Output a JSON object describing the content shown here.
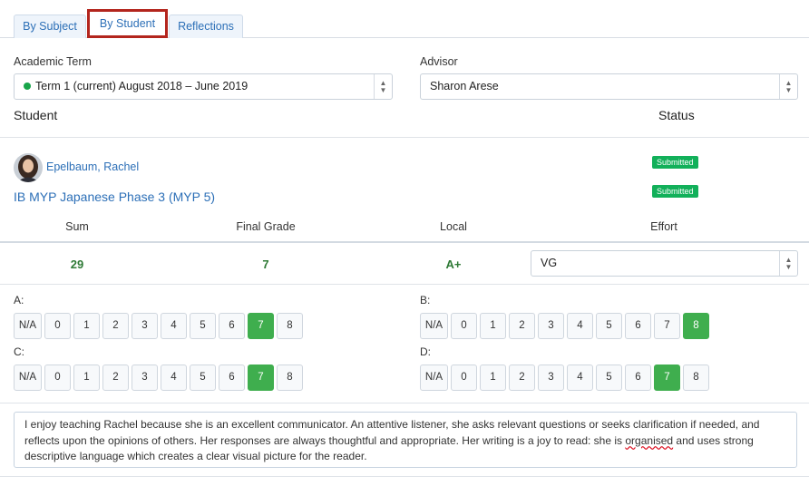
{
  "tabs": [
    {
      "label": "By Subject"
    },
    {
      "label": "By Student"
    },
    {
      "label": "Reflections"
    }
  ],
  "term": {
    "label": "Academic Term",
    "value": "Term 1 (current) August 2018 – June 2019"
  },
  "advisor": {
    "label": "Advisor",
    "value": "Sharon Arese"
  },
  "table": {
    "student_header": "Student",
    "status_header": "Status"
  },
  "student": {
    "name": "Epelbaum, Rachel",
    "status": "Submitted"
  },
  "course": {
    "name": "IB MYP Japanese Phase 3 (MYP 5)",
    "status": "Submitted"
  },
  "grades": {
    "sum_label": "Sum",
    "final_label": "Final Grade",
    "local_label": "Local",
    "effort_label": "Effort",
    "sum": "29",
    "final": "7",
    "local": "A+",
    "effort": "VG"
  },
  "criteria": [
    {
      "label": "A:",
      "options": [
        "N/A",
        "0",
        "1",
        "2",
        "3",
        "4",
        "5",
        "6",
        "7",
        "8"
      ],
      "selected": "7"
    },
    {
      "label": "B:",
      "options": [
        "N/A",
        "0",
        "1",
        "2",
        "3",
        "4",
        "5",
        "6",
        "7",
        "8"
      ],
      "selected": "8"
    },
    {
      "label": "C:",
      "options": [
        "N/A",
        "0",
        "1",
        "2",
        "3",
        "4",
        "5",
        "6",
        "7",
        "8"
      ],
      "selected": "7"
    },
    {
      "label": "D:",
      "options": [
        "N/A",
        "0",
        "1",
        "2",
        "3",
        "4",
        "5",
        "6",
        "7",
        "8"
      ],
      "selected": "7"
    }
  ],
  "comment": {
    "before": "I enjoy teaching Rachel because she is an excellent communicator. An attentive listener, she asks relevant questions or seeks clarification if needed, and reflects upon the opinions of others. Her responses are always thoughtful and appropriate. Her writing is a joy to read: she is ",
    "flagged": "organised",
    "after": " and uses strong descriptive language which creates a clear visual picture for the reader."
  },
  "colors": {
    "accent": "#2c6fb7",
    "selected": "#3fae4e",
    "badge": "#12b05a",
    "highlight": "#b3251d"
  }
}
